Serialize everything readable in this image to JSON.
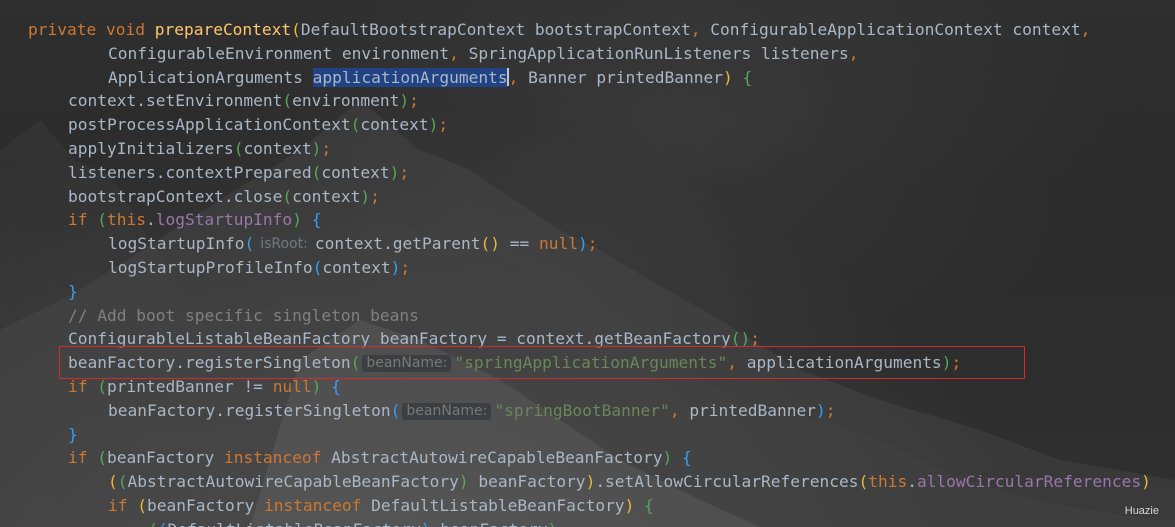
{
  "editor": {
    "colors": {
      "background": "#2b2b2b",
      "keyword": "#cc7832",
      "method": "#ffc66d",
      "field": "#9876aa",
      "string": "#6a8759",
      "comment": "#808080",
      "plain": "#a9b7c6",
      "selection": "#214283",
      "annotation_box": "#d32b2b"
    },
    "lines": [
      {
        "indent": 0,
        "tokens": [
          {
            "t": "private",
            "c": "kw"
          },
          {
            "t": " "
          },
          {
            "t": "void",
            "c": "kw"
          },
          {
            "t": " "
          },
          {
            "t": "prepareContext",
            "c": "fn"
          },
          {
            "t": "(",
            "c": "p1"
          },
          {
            "t": "DefaultBootstrapContext bootstrapContext"
          },
          {
            "t": ", ",
            "c": "kw"
          },
          {
            "t": "ConfigurableApplicationContext context"
          },
          {
            "t": ",",
            "c": "kw"
          }
        ]
      },
      {
        "indent": 2,
        "tokens": [
          {
            "t": "ConfigurableEnvironment environment"
          },
          {
            "t": ", ",
            "c": "kw"
          },
          {
            "t": "SpringApplicationRunListeners listeners"
          },
          {
            "t": ",",
            "c": "kw"
          }
        ]
      },
      {
        "indent": 2,
        "tokens": [
          {
            "t": "ApplicationArguments "
          },
          {
            "t": "applicationArguments",
            "c": "sel"
          },
          {
            "caret": true
          },
          {
            "t": ", ",
            "c": "kw"
          },
          {
            "t": "Banner printedBanner"
          },
          {
            "t": ")",
            "c": "p1"
          },
          {
            "t": " "
          },
          {
            "t": "{",
            "c": "p2"
          }
        ]
      },
      {
        "indent": 1,
        "tokens": [
          {
            "t": "context.setEnvironment"
          },
          {
            "t": "(",
            "c": "p2"
          },
          {
            "t": "environment"
          },
          {
            "t": ")",
            "c": "p2"
          },
          {
            "t": ";",
            "c": "kw"
          }
        ]
      },
      {
        "indent": 1,
        "tokens": [
          {
            "t": "postProcessApplicationContext"
          },
          {
            "t": "(",
            "c": "p2"
          },
          {
            "t": "context"
          },
          {
            "t": ")",
            "c": "p2"
          },
          {
            "t": ";",
            "c": "kw"
          }
        ]
      },
      {
        "indent": 1,
        "tokens": [
          {
            "t": "applyInitializers"
          },
          {
            "t": "(",
            "c": "p2"
          },
          {
            "t": "context"
          },
          {
            "t": ")",
            "c": "p2"
          },
          {
            "t": ";",
            "c": "kw"
          }
        ]
      },
      {
        "indent": 1,
        "tokens": [
          {
            "t": "listeners.contextPrepared"
          },
          {
            "t": "(",
            "c": "p2"
          },
          {
            "t": "context"
          },
          {
            "t": ")",
            "c": "p2"
          },
          {
            "t": ";",
            "c": "kw"
          }
        ]
      },
      {
        "indent": 1,
        "tokens": [
          {
            "t": "bootstrapContext.close"
          },
          {
            "t": "(",
            "c": "p2"
          },
          {
            "t": "context"
          },
          {
            "t": ")",
            "c": "p2"
          },
          {
            "t": ";",
            "c": "kw"
          }
        ]
      },
      {
        "indent": 1,
        "tokens": [
          {
            "t": "if",
            "c": "kw"
          },
          {
            "t": " "
          },
          {
            "t": "(",
            "c": "p2"
          },
          {
            "t": "this",
            "c": "kw"
          },
          {
            "t": "."
          },
          {
            "t": "logStartupInfo",
            "c": "fld"
          },
          {
            "t": ")",
            "c": "p2"
          },
          {
            "t": " "
          },
          {
            "t": "{",
            "c": "p3"
          }
        ]
      },
      {
        "indent": 2,
        "tokens": [
          {
            "t": "logStartupInfo"
          },
          {
            "t": "(",
            "c": "p3"
          },
          {
            "hint": "isRoot:"
          },
          {
            "t": "context.getParent"
          },
          {
            "t": "()",
            "c": "p1"
          },
          {
            "t": " == "
          },
          {
            "t": "null",
            "c": "kw"
          },
          {
            "t": ")",
            "c": "p3"
          },
          {
            "t": ";",
            "c": "kw"
          }
        ]
      },
      {
        "indent": 2,
        "tokens": [
          {
            "t": "logStartupProfileInfo"
          },
          {
            "t": "(",
            "c": "p3"
          },
          {
            "t": "context"
          },
          {
            "t": ")",
            "c": "p3"
          },
          {
            "t": ";",
            "c": "kw"
          }
        ]
      },
      {
        "indent": 1,
        "tokens": [
          {
            "t": "}",
            "c": "p3"
          }
        ]
      },
      {
        "indent": 1,
        "tokens": [
          {
            "t": "// Add boot specific singleton beans",
            "c": "cm"
          }
        ]
      },
      {
        "indent": 1,
        "tokens": [
          {
            "t": "ConfigurableListableBeanFactory beanFactory = context.getBeanFactory"
          },
          {
            "t": "()",
            "c": "p2"
          },
          {
            "t": ";",
            "c": "kw"
          }
        ]
      },
      {
        "indent": 1,
        "tokens": [
          {
            "t": "beanFactory.registerSingleton"
          },
          {
            "t": "(",
            "c": "p2"
          },
          {
            "hint": "beanName:"
          },
          {
            "t": "\"springApplicationArguments\"",
            "c": "str"
          },
          {
            "t": ", ",
            "c": "kw"
          },
          {
            "t": "applicationArguments"
          },
          {
            "t": ")",
            "c": "p2"
          },
          {
            "t": ";",
            "c": "kw"
          }
        ]
      },
      {
        "indent": 1,
        "tokens": [
          {
            "t": "if",
            "c": "kw"
          },
          {
            "t": " "
          },
          {
            "t": "(",
            "c": "p2"
          },
          {
            "t": "printedBanner != "
          },
          {
            "t": "null",
            "c": "kw"
          },
          {
            "t": ")",
            "c": "p2"
          },
          {
            "t": " "
          },
          {
            "t": "{",
            "c": "p3"
          }
        ]
      },
      {
        "indent": 2,
        "tokens": [
          {
            "t": "beanFactory.registerSingleton"
          },
          {
            "t": "(",
            "c": "p3"
          },
          {
            "hint": "beanName:"
          },
          {
            "t": "\"springBootBanner\"",
            "c": "str"
          },
          {
            "t": ", ",
            "c": "kw"
          },
          {
            "t": "printedBanner"
          },
          {
            "t": ")",
            "c": "p3"
          },
          {
            "t": ";",
            "c": "kw"
          }
        ]
      },
      {
        "indent": 1,
        "tokens": [
          {
            "t": "}",
            "c": "p3"
          }
        ]
      },
      {
        "indent": 1,
        "tokens": [
          {
            "t": "if",
            "c": "kw"
          },
          {
            "t": " "
          },
          {
            "t": "(",
            "c": "p2"
          },
          {
            "t": "beanFactory "
          },
          {
            "t": "instanceof",
            "c": "kw"
          },
          {
            "t": " AbstractAutowireCapableBeanFactory"
          },
          {
            "t": ")",
            "c": "p2"
          },
          {
            "t": " "
          },
          {
            "t": "{",
            "c": "p3"
          }
        ]
      },
      {
        "indent": 2,
        "tokens": [
          {
            "t": "(",
            "c": "p1"
          },
          {
            "t": "(",
            "c": "p2"
          },
          {
            "t": "AbstractAutowireCapableBeanFactory"
          },
          {
            "t": ")",
            "c": "p2"
          },
          {
            "t": " beanFactory"
          },
          {
            "t": ")",
            "c": "p1"
          },
          {
            "t": ".setAllowCircularReferences"
          },
          {
            "t": "(",
            "c": "p1"
          },
          {
            "t": "this",
            "c": "kw"
          },
          {
            "t": "."
          },
          {
            "t": "allowCircularReferences",
            "c": "fld"
          },
          {
            "t": ")",
            "c": "p1"
          }
        ]
      },
      {
        "indent": 2,
        "tokens": [
          {
            "t": "if",
            "c": "kw"
          },
          {
            "t": " "
          },
          {
            "t": "(",
            "c": "p1"
          },
          {
            "t": "beanFactory "
          },
          {
            "t": "instanceof",
            "c": "kw"
          },
          {
            "t": " DefaultListableBeanFactory"
          },
          {
            "t": ")",
            "c": "p1"
          },
          {
            "t": " "
          },
          {
            "t": "{",
            "c": "p2"
          }
        ]
      },
      {
        "indent": 3,
        "tokens": [
          {
            "t": "(",
            "c": "p2"
          },
          {
            "t": "(",
            "c": "p3"
          },
          {
            "t": "DefaultListableBeanFactory"
          },
          {
            "t": ")",
            "c": "p3"
          },
          {
            "t": " beanFactory"
          },
          {
            "t": ")",
            "c": "p2"
          }
        ]
      }
    ]
  },
  "watermark": "Huazie"
}
